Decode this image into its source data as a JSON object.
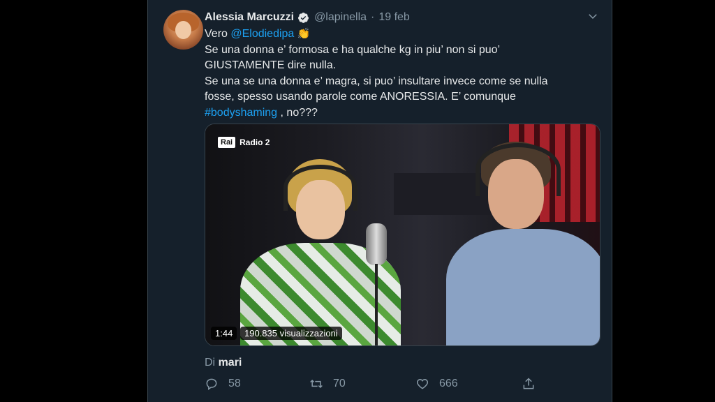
{
  "tweet": {
    "author_name": "Alessia Marcuzzi",
    "handle": "@lapinella",
    "separator": "·",
    "date": "19 feb",
    "line1_prefix": "Vero ",
    "mention": "@Elodiedipa",
    "clap_emoji": "👏",
    "line2": "Se una donna e’ formosa e ha qualche kg in piu’ non si puo’",
    "line3": "GIUSTAMENTE dire nulla.",
    "line4": "Se una se una donna e’ magra, si puo’ insultare invece come se nulla",
    "line5": "fosse, spesso usando parole come ANORESSIA. E’ comunque",
    "hashtag": "#bodyshaming",
    "line6_suffix": " , no???"
  },
  "video": {
    "channel_logo": "Rai",
    "channel_name": "Radio 2",
    "duration": "1:44",
    "views": "190.835 visualizzazioni"
  },
  "attribution": {
    "prefix": "Di ",
    "name": "mari"
  },
  "actions": {
    "replies": "58",
    "retweets": "70",
    "likes": "666"
  },
  "colors": {
    "background": "#15202b",
    "link": "#1da1f2",
    "muted": "#8899a6"
  },
  "icons": [
    "verified-badge-icon",
    "chevron-down-icon",
    "reply-icon",
    "retweet-icon",
    "like-icon",
    "share-icon"
  ]
}
